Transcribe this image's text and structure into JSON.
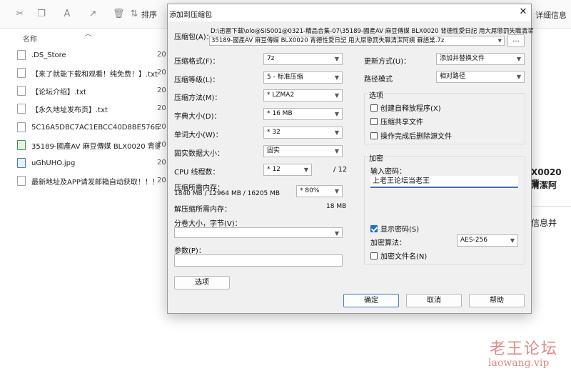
{
  "explorer": {
    "sort_label": "排序",
    "details_label": "详细信息",
    "column_name": "名称",
    "files": [
      {
        "name": ".DS_Store",
        "date": "20",
        "icon": "file-icon"
      },
      {
        "name": "【来了就能下载和观看！纯免费！】.txt",
        "date": "20",
        "icon": "text-file-icon"
      },
      {
        "name": "【论坛介绍】.txt",
        "date": "20",
        "icon": "text-file-icon"
      },
      {
        "name": "【永久地址发布页】.txt",
        "date": "20",
        "icon": "text-file-icon"
      },
      {
        "name": "5C16A5DBC7AC1EBCC40D8BE576EC...",
        "date": "20",
        "icon": "file-icon"
      },
      {
        "name": "35189-國產AV 麻豆傳媒 BLX0020 背德...",
        "date": "20",
        "icon": "video-file-icon"
      },
      {
        "name": "uGhUHO.jpg",
        "date": "20",
        "icon": "image-file-icon"
      },
      {
        "name": "最新地址及APP请发邮箱自动获取！！！...",
        "date": "20",
        "icon": "text-file-icon"
      }
    ],
    "right_text_1": "X0020 背",
    "right_text_2": "清潔阿",
    "right_text_3": "信息并",
    "watermark_cn": "老王论坛",
    "watermark_en": "laowang.vip"
  },
  "dialog": {
    "title": "添加到压缩包",
    "archive_label": "压缩包(A)：",
    "archive_path_dir": "D:\\迅雷下载\\olo@SIS001@0321-精品合集-07\\35189-國產AV 麻豆傳媒 BLX0020 背德性愛日記 用大屌懲罰失職清潔",
    "archive_path_file": "35189-國產AV 麻豆傳媒 BLX0020 背德性愛日記 用大屌懲罰失職清潔阿姨 蘇語棠.7z",
    "browse_label": "...",
    "format_label": "压缩格式(F)：",
    "format_value": "7z",
    "level_label": "压缩等级(L)：",
    "level_value": "5 - 标准压缩",
    "method_label": "压缩方法(M)：",
    "method_value": "* LZMA2",
    "dict_label": "字典大小(D)：",
    "dict_value": "* 16 MB",
    "word_label": "单词大小(W)：",
    "word_value": "* 32",
    "solid_label": "固实数据大小：",
    "solid_value": "固实",
    "cpu_label": "CPU 线程数：",
    "cpu_value": "* 12",
    "cpu_total": "/ 12",
    "mem_label": "压缩所需内存：",
    "mem_detail": "1840 MB / 12964 MB / 16205 MB",
    "mem_value": "* 80%",
    "decomp_label": "解压缩所需内存：",
    "decomp_value": "18 MB",
    "split_label": "分卷大小，字节(V)：",
    "params_label": "参数(P)：",
    "options_button": "选项",
    "update_label": "更新方式(U)：",
    "update_value": "添加并替换文件",
    "path_mode_label": "路径模式",
    "path_mode_value": "相对路径",
    "options_group": "选项",
    "opt_sfx": "创建自释放程序(X)",
    "opt_shared": "压缩共享文件",
    "opt_delete": "操作完成后删除源文件",
    "encrypt_group": "加密",
    "password_label": "输入密码：",
    "password_value": "上老王论坛当老王",
    "show_password": "显示密码(S)",
    "enc_method_label": "加密算法：",
    "enc_method_value": "AES-256",
    "encrypt_names": "加密文件名(N)",
    "ok_button": "确定",
    "cancel_button": "取消",
    "help_button": "帮助"
  }
}
